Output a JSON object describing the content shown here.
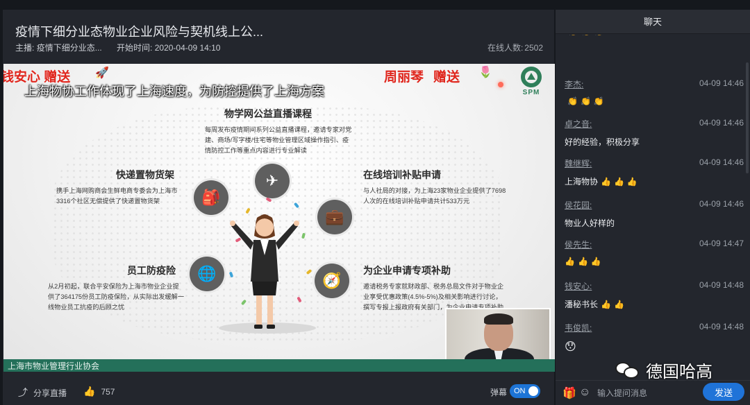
{
  "header": {
    "title": "疫情下细分业态物业企业风险与契机线上公...",
    "host_label": "主播:",
    "host_value": "疫情下细分业态...",
    "start_label": "开始时间:",
    "start_value": "2020-04-09 14:10",
    "online_label": "在线人数:",
    "online_value": "2502"
  },
  "slide": {
    "gift_left_text": "钱安心 赠送",
    "gift_right_name": "周丽琴",
    "gift_right_word": "赠送",
    "subtitle": "上海物协工作体现了上海速度，为防控提供了上海方案",
    "logo_text": "SPM",
    "center_heading": "物学网公益直播课程",
    "center_text": "每周发布疫情期间系列公益直播课程，邀请专家对党建、商场/写字楼/住宅等物业管理区域操作指引、疫情防控工作等重点内容进行专业解读",
    "s1_heading": "快递置物货架",
    "s1_text": "携手上海网购商会生鲜电商专委会为上海市3316个社区无偿提供了快递置物货架",
    "s2_heading": "在线培训补贴申请",
    "s2_text": "与人社局的对接，为上海23家物业企业提供了7698人次的在线培训补贴申请共计533万元",
    "s3_heading": "员工防疫险",
    "s3_text": "从2月初起，联合平安保险为上海市物业企业提供了364175份员工防疫保险，从实际出发缓解一线物业员工抗疫的后顾之忧",
    "s4_heading": "为企业申请专项补助",
    "s4_text": "邀请税务专家就财政部、税务总局文件对于物业企业享受优惠政策(4.5%-5%)及相关影响进行讨论，撰写专报上报政府有关部门，为企业申请专项补助",
    "footer_org": "上海市物业管理行业协会"
  },
  "controls": {
    "share_label": "分享直播",
    "like_count": "757",
    "danmu_label": "弹幕",
    "toggle_label": "ON"
  },
  "chat": {
    "header": "聊天",
    "messages": [
      {
        "name": "",
        "time": "",
        "text": ""
      },
      {
        "name": "李杰:",
        "time": "04-09 14:46",
        "text": ""
      },
      {
        "name": "卓之音:",
        "time": "04-09 14:46",
        "text": "好的经验，积极分享"
      },
      {
        "name": "魏继辉:",
        "time": "04-09 14:46",
        "text": "上海物协"
      },
      {
        "name": "侯花园:",
        "time": "04-09 14:46",
        "text": "物业人好样的"
      },
      {
        "name": "侯先生:",
        "time": "04-09 14:47",
        "text": ""
      },
      {
        "name": "钱安心:",
        "time": "04-09 14:48",
        "text": "潘秘书长"
      },
      {
        "name": "韦俊凯:",
        "time": "04-09 14:48",
        "text": ""
      }
    ],
    "input_placeholder": "输入提问消息",
    "send_label": "发送"
  },
  "watermark": {
    "text": "德国哈高"
  },
  "colors": {
    "accent": "#1f73d8",
    "slide_green": "#24705a",
    "gift_red": "#e0261d",
    "panel": "#23262d"
  },
  "icons": [
    "share-icon",
    "thumbs-up-icon",
    "gift-icon",
    "emoji-icon",
    "plane-icon",
    "backpack-icon",
    "briefcase-icon",
    "globe-icon",
    "compass-icon",
    "clap-emoji",
    "thumbs-up-emoji",
    "surprised-emoji",
    "wechat-logo"
  ]
}
